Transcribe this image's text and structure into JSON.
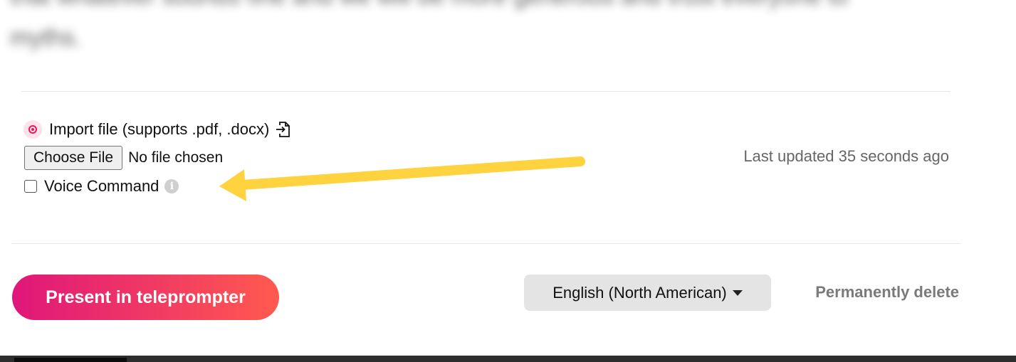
{
  "background_text": {
    "line1": "that whatever sounds fine and we will be more generous and trust everyone to",
    "line2": "myths."
  },
  "import": {
    "label": "Import file (supports .pdf, .docx)",
    "icon": "file-import-icon",
    "leading_icon": "target-icon"
  },
  "file_input": {
    "button_label": "Choose File",
    "status": "No file chosen"
  },
  "voice_command": {
    "label": "Voice Command",
    "checked": false,
    "info_icon": "info-icon",
    "info_glyph": "i"
  },
  "last_updated": "Last updated 35 seconds ago",
  "annotation": {
    "arrow_color": "#FFD23F"
  },
  "actions": {
    "present_label": "Present in teleprompter",
    "language": "English (North American)",
    "delete_label": "Permanently delete"
  },
  "colors": {
    "accent_start": "#e0167a",
    "accent_end": "#ff5a4f",
    "muted": "#7a7a7a"
  }
}
